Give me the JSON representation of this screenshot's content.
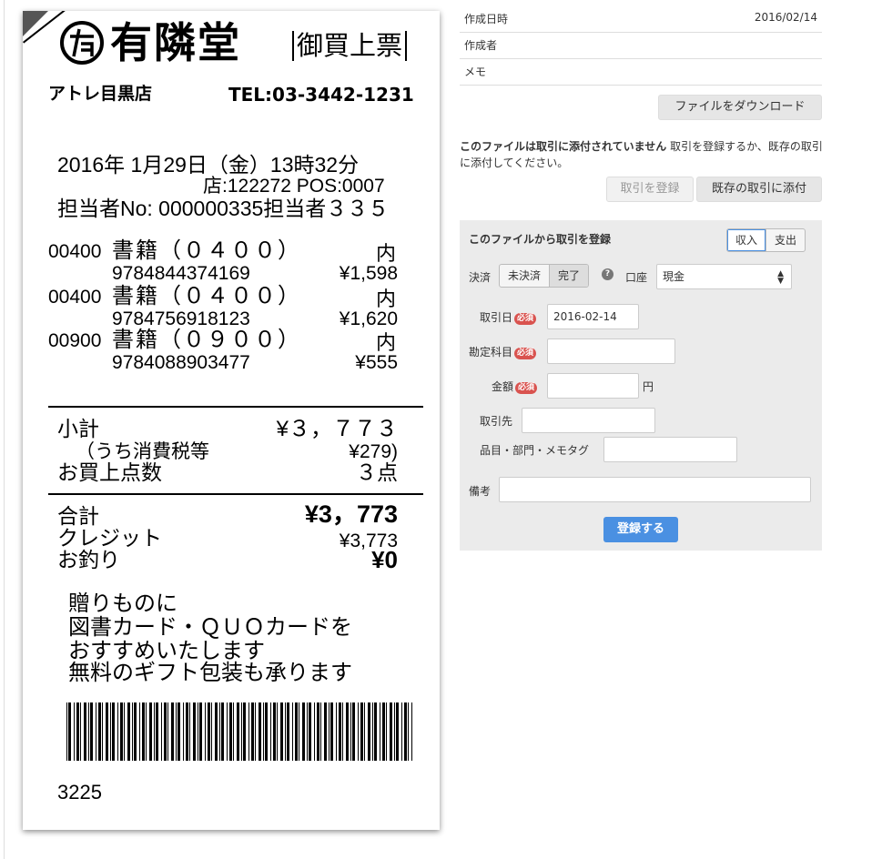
{
  "receipt": {
    "store_name": "有隣堂",
    "receipt_type": "御買上票",
    "branch": "アトレ目黒店",
    "tel": "TEL:03-3442-1231",
    "datetime": "2016年 1月29日（金）13時32分",
    "store_pos": "店:122272 POS:0007",
    "staff": "担当者No: 000000335担当者３３５",
    "items": [
      {
        "code": "00400",
        "name": "書籍（０４００）",
        "tax": "内",
        "isbn": "9784844374169",
        "price": "¥1,598"
      },
      {
        "code": "00400",
        "name": "書籍（０４００）",
        "tax": "内",
        "isbn": "9784756918123",
        "price": "¥1,620"
      },
      {
        "code": "00900",
        "name": "書籍（０９００）",
        "tax": "内",
        "isbn": "9784088903477",
        "price": "¥555"
      }
    ],
    "subtotal_label": "小計",
    "subtotal_value": "¥３，７７３",
    "tax_label": "（うち消費税等",
    "tax_value": "¥279)",
    "count_label": "お買上点数",
    "count_value": "３点",
    "total_label": "合計",
    "total_value": "¥3，773",
    "credit_label": "クレジット",
    "credit_value": "¥3,773",
    "change_label": "お釣り",
    "change_value": "¥0",
    "message_lines": [
      "贈りものに",
      "図書カード・ＱＵＯカードを",
      "おすすめいたします",
      "無料のギフト包装も承ります"
    ],
    "barcode_number": "3225"
  },
  "meta": {
    "created_label": "作成日時",
    "created_value": "2016/02/14",
    "author_label": "作成者",
    "author_value": "",
    "memo_label": "メモ",
    "memo_value": ""
  },
  "download_button": "ファイルをダウンロード",
  "note": {
    "bold": "このファイルは取引に添付されていません",
    "rest": " 取引を登録するか、既存の取引に添付してください。"
  },
  "register_button": "取引を登録",
  "attach_button": "既存の取引に添付",
  "form": {
    "title": "このファイルから取引を登録",
    "income": "収入",
    "expense": "支出",
    "settle_label": "決済",
    "unsettled": "未決済",
    "settled": "完了",
    "help_icon": "?",
    "account_label": "口座",
    "account_value": "現金",
    "date_label": "取引日",
    "required": "必須",
    "date_value": "2016-02-14",
    "category_label": "勘定科目",
    "category_value": "",
    "amount_label": "金額",
    "amount_value": "",
    "yen": "円",
    "partner_label": "取引先",
    "partner_value": "",
    "tags_label": "品目・部門・メモタグ",
    "tags_value": "",
    "remarks_label": "備考",
    "remarks_value": "",
    "submit": "登録する"
  }
}
